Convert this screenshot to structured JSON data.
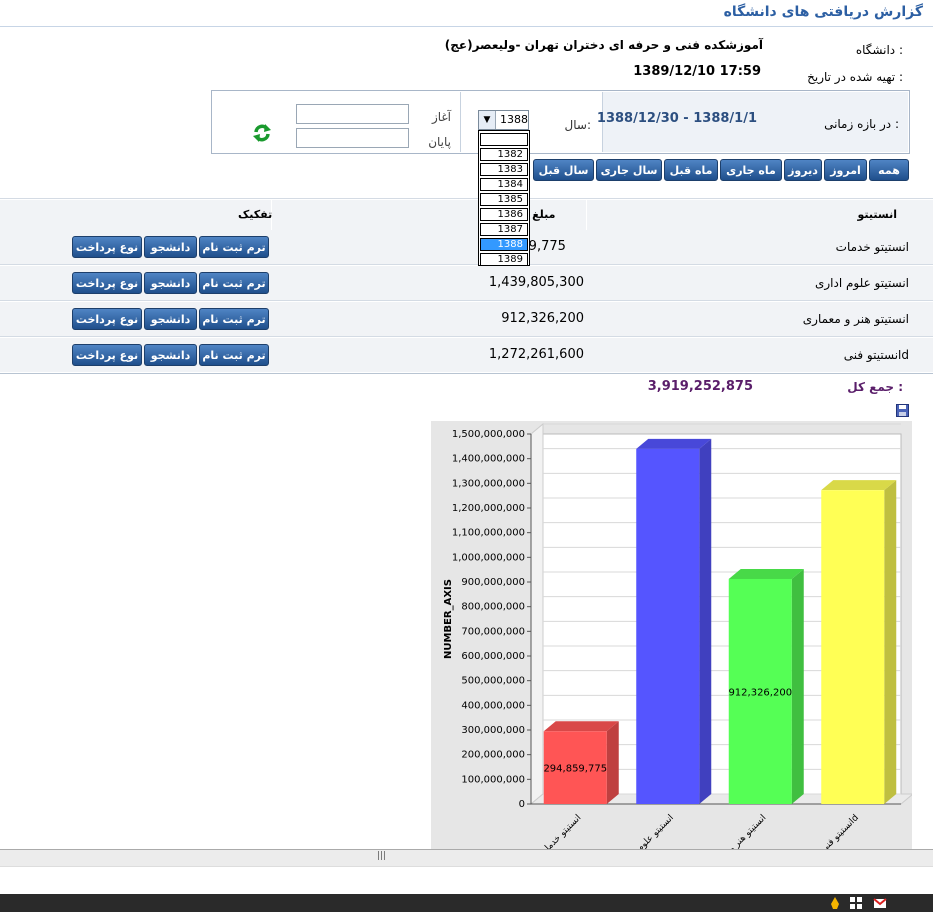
{
  "header": {
    "title": "گزارش دریافتی های دانشگاه",
    "university_label": "دانشگاه :",
    "university_name": "آموزشکده فنی و حرفه ای دختران تهران -ولیعصر(عج)",
    "prepared_label": "تهیه شده در تاریخ :",
    "prepared_value": "1389/12/10 17:59"
  },
  "filter": {
    "range_label": "در بازه زمانی :",
    "range_value": "1388/12/30 - 1388/1/1",
    "year_label": "سال:",
    "year_selected": "1388",
    "year_options": [
      "",
      "1382",
      "1383",
      "1384",
      "1385",
      "1386",
      "1387",
      "1388",
      "1389"
    ],
    "start_label": "آغاز",
    "end_label": "پایان",
    "start_value": "",
    "end_value": ""
  },
  "period_buttons": [
    "همه",
    "امروز",
    "دیروز",
    "ماه جاری",
    "ماه قبل",
    "سال جاری",
    "سال قبل"
  ],
  "table": {
    "headers": {
      "institute": "انستیتو",
      "amount": "مبلغ دریا",
      "breakdown": "تفکیک"
    },
    "rows": [
      {
        "institute": "انستیتو خدمات",
        "amount": ",859,775"
      },
      {
        "institute": "انستیتو علوم اداری",
        "amount": "1,439,805,300"
      },
      {
        "institute": "انستیتو هنر و معماری",
        "amount": "912,326,200"
      },
      {
        "institute": "انستیتو فنیd",
        "amount": "1,272,261,600"
      }
    ],
    "row_buttons": {
      "term": "ترم ثبت نام",
      "student": "دانشجو",
      "payment": "نوع پرداخت"
    }
  },
  "total": {
    "label": "جمع کل :",
    "value": "3,919,252,875"
  },
  "chart_data": {
    "type": "bar",
    "categories": [
      "انستیتو خدمات",
      "انستیتو علوم ادا",
      "انستیتو هنر و م",
      "انستیتو فنیd"
    ],
    "values": [
      294859775,
      1439805300,
      912326200,
      1272261600
    ],
    "data_labels": [
      "294,859,775",
      "",
      "912,326,200",
      ""
    ],
    "colors": [
      "#ff5555",
      "#5555ff",
      "#55ff55",
      "#ffff55"
    ],
    "ylabel": "NUMBER_AXIS",
    "ylim": [
      0,
      1500000000
    ],
    "yticks": [
      "0",
      "100,000,000",
      "200,000,000",
      "300,000,000",
      "400,000,000",
      "500,000,000",
      "600,000,000",
      "700,000,000",
      "800,000,000",
      "900,000,000",
      "1,000,000,000",
      "1,100,000,000",
      "1,200,000,000",
      "1,300,000,000",
      "1,400,000,000",
      "1,500,000,000"
    ],
    "grid": true,
    "style": "3d"
  },
  "statusbar": {
    "scroll_grip": "|||"
  }
}
